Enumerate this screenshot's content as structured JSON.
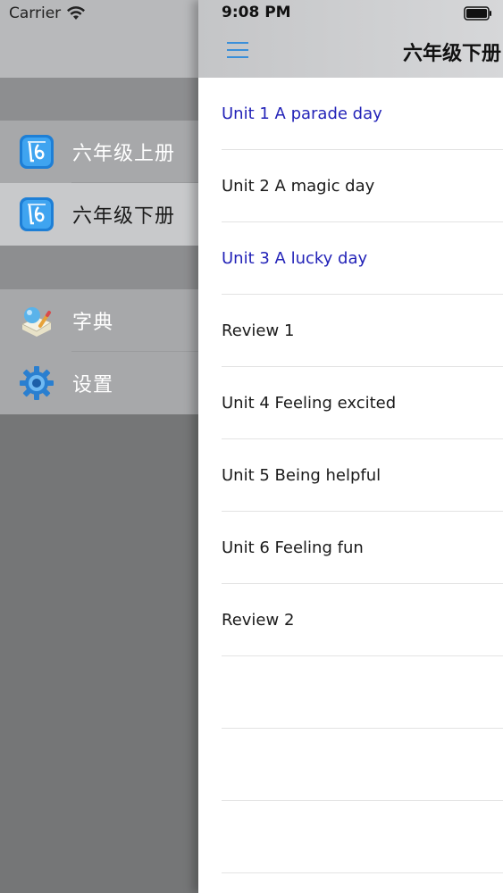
{
  "status_bar": {
    "carrier": "Carrier",
    "time": "9:08 PM"
  },
  "header": {
    "title": "六年级下册",
    "menu_icon": "hamburger-menu-icon"
  },
  "sidebar": {
    "groups": [
      {
        "items": [
          {
            "label": "六年级上册",
            "icon": "book-app-icon",
            "selected": false
          },
          {
            "label": "六年级下册",
            "icon": "book-app-icon",
            "selected": true
          }
        ]
      },
      {
        "items": [
          {
            "label": "字典",
            "icon": "dictionary-icon",
            "selected": false
          },
          {
            "label": "设置",
            "icon": "gear-icon",
            "selected": false
          }
        ]
      }
    ]
  },
  "units": [
    {
      "title": "Unit 1 A parade day",
      "highlighted": true
    },
    {
      "title": "Unit 2 A magic day",
      "highlighted": false
    },
    {
      "title": "Unit 3 A lucky day",
      "highlighted": true
    },
    {
      "title": "Review 1",
      "highlighted": false
    },
    {
      "title": "Unit 4 Feeling excited",
      "highlighted": false
    },
    {
      "title": "Unit 5 Being helpful",
      "highlighted": false
    },
    {
      "title": "Unit 6 Feeling fun",
      "highlighted": false
    },
    {
      "title": "Review 2",
      "highlighted": false
    },
    {
      "title": "",
      "highlighted": false
    },
    {
      "title": "",
      "highlighted": false
    },
    {
      "title": "",
      "highlighted": false
    }
  ],
  "colors": {
    "highlight_text": "#2323b8",
    "menu_icon": "#3a8fd9"
  }
}
